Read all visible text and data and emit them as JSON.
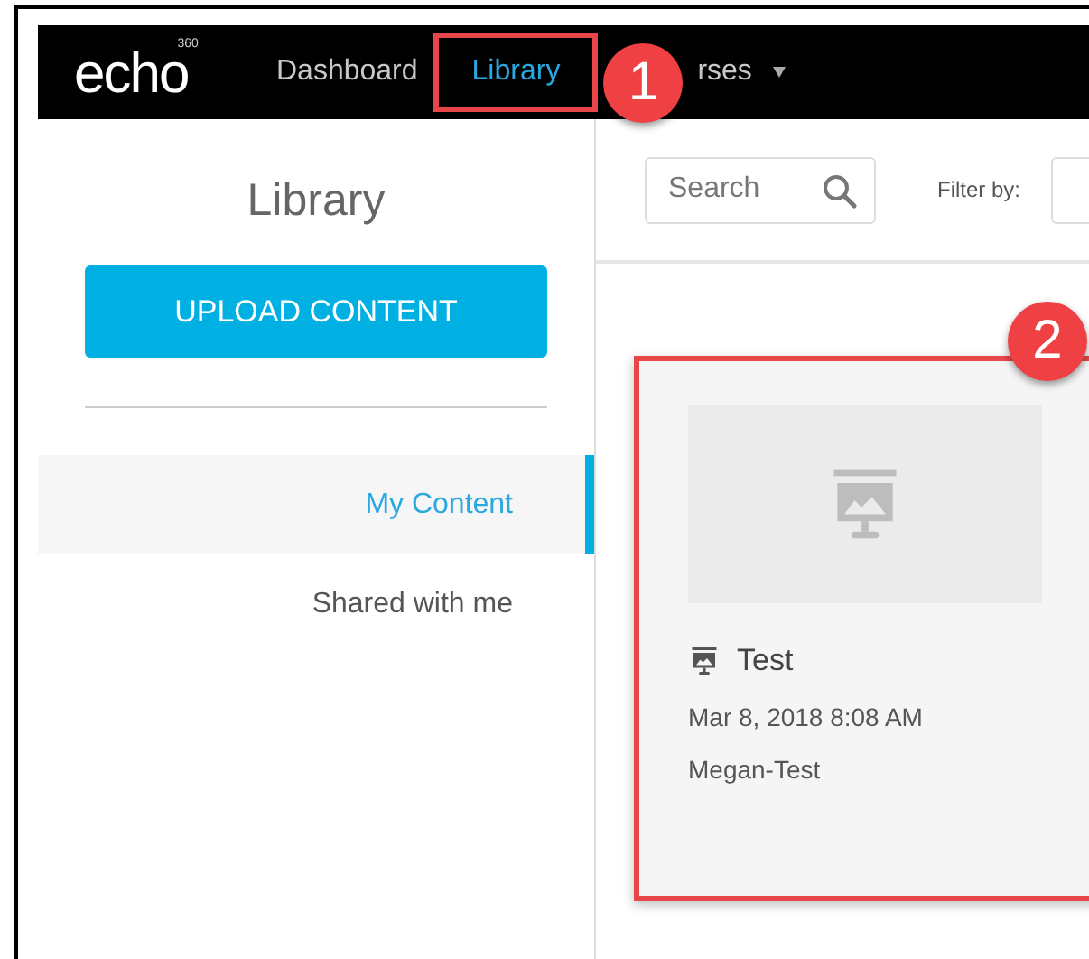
{
  "logo": {
    "text": "echo",
    "superscript": "360"
  },
  "nav": [
    {
      "label": "Dashboard",
      "selected": false
    },
    {
      "label": "Library",
      "selected": true,
      "callout": "1"
    },
    {
      "label": "rses",
      "selected": false,
      "dropdown": true
    }
  ],
  "sidebar": {
    "title": "Library",
    "upload_button": "UPLOAD CONTENT",
    "items": [
      {
        "label": "My Content",
        "selected": true
      },
      {
        "label": "Shared with me",
        "selected": false
      }
    ]
  },
  "toolbar": {
    "search": {
      "placeholder": "Search"
    },
    "filter_label": "Filter by:"
  },
  "cards": [
    {
      "kind": "presentation",
      "title": "Test",
      "date": "Mar 8, 2018 8:08 AM",
      "owner": "Megan-Test",
      "callout": "2"
    }
  ]
}
